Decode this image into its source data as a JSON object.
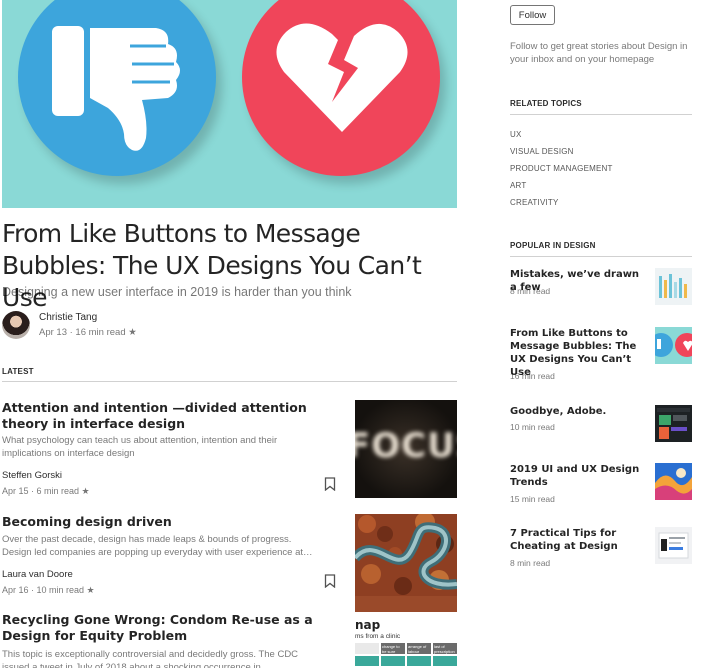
{
  "main_article": {
    "title": "From Like Buttons to Message Bubbles: The UX Designs You Can’t Use",
    "subtitle": "Designing a new user interface in 2019 is harder than you think",
    "author": "Christie Tang",
    "meta": "Apr 13 · 16 min read ★"
  },
  "latest": {
    "label": "LATEST",
    "stories": [
      {
        "title": "Attention and intention —divided attention theory in interface design",
        "description": "What psychology can teach us about attention, intention and their implications on interface design",
        "author": "Steffen Gorski",
        "meta": "Apr 15 · 6 min read ★",
        "thumb_text": "FOCUS"
      },
      {
        "title": "Becoming design driven",
        "description": "Over the past decade, design has made leaps & bounds of progress. Design led companies are popping up everyday with user experience at…",
        "author": "Laura van Doore",
        "meta": "Apr 16 · 10 min read ★"
      },
      {
        "title": "Recycling Gone Wrong: Condom Re-use as a Design for Equity Problem",
        "description": "This topic is exceptionally controversial and decidedly gross. The CDC issued a tweet in July of 2018 about a shocking occurrence in",
        "thumb_heading": "nap",
        "thumb_sub": "ms from a clinic",
        "thumb_cells": [
          "",
          "change to be sure",
          "arrange of labour",
          "last of prescription",
          "",
          ""
        ]
      }
    ]
  },
  "sidebar": {
    "follow_label": "Follow",
    "follow_text": "Follow to get great stories about Design in your inbox and on your homepage",
    "related_label": "RELATED TOPICS",
    "topics": [
      "UX",
      "VISUAL DESIGN",
      "PRODUCT MANAGEMENT",
      "ART",
      "CREATIVITY"
    ],
    "popular_label": "POPULAR IN DESIGN",
    "popular": [
      {
        "title": "Mistakes, we’ve drawn a few",
        "meta": "8 min read"
      },
      {
        "title": "From Like Buttons to Message Bubbles: The UX Designs You Can’t Use",
        "meta": "16 min read"
      },
      {
        "title": "Goodbye, Adobe.",
        "meta": "10 min read"
      },
      {
        "title": "2019 UI and UX Design Trends",
        "meta": "15 min read"
      },
      {
        "title": "7 Practical Tips for Cheating at Design",
        "meta": "8 min read"
      }
    ]
  },
  "colors": {
    "hero_bg": "#8ad9d6",
    "hero_blue": "#3da5dc",
    "hero_red": "#f0455a"
  },
  "icons": [
    "thumbs-down-icon",
    "broken-heart-icon",
    "bookmark-icon",
    "star-icon"
  ]
}
